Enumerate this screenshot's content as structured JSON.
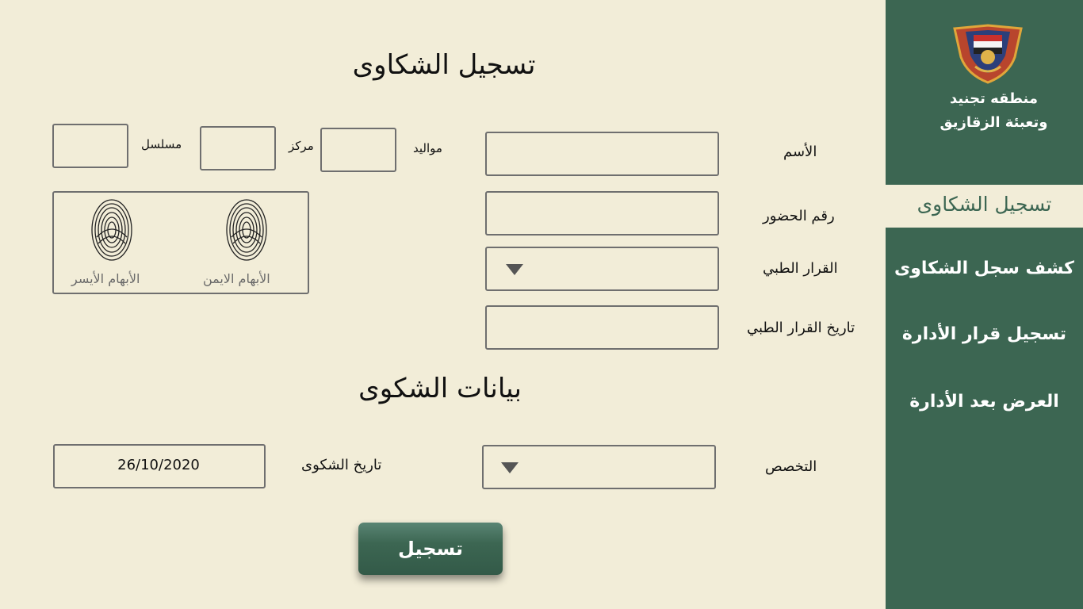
{
  "sidebar": {
    "org_line1": "منطقه تجنيد",
    "org_line2": "وتعبئة الزقازيق",
    "items": [
      {
        "label": "تسجيل الشكاوى",
        "active": true
      },
      {
        "label": "كشف  سجل الشكاوى",
        "active": false
      },
      {
        "label": "تسجيل قرار الأدارة",
        "active": false
      },
      {
        "label": "العرض بعد الأدارة",
        "active": false
      }
    ],
    "accent_color": "#3c6652"
  },
  "form": {
    "title": "تسجيل الشكاوى",
    "name_label": "الأسم",
    "attendance_label": "رقم الحضور",
    "medical_decision_label": "القرار الطبي",
    "medical_decision_date_label": "تاريخ القرار الطبي",
    "birth_label": "مواليد",
    "center_label": "مركز",
    "serial_label": "مسلسل",
    "right_thumb_label": "الأبهام الايمن",
    "left_thumb_label": "الأبهام الأيسر",
    "name_value": "",
    "attendance_value": "",
    "birth_value": "",
    "center_value": "",
    "serial_value": "",
    "medical_decision_date_value": ""
  },
  "complaint": {
    "title": "بيانات الشكوى",
    "specialty_label": "التخصص",
    "date_label": "تاريخ الشكوى",
    "date_value": "26/10/2020",
    "submit_label": "تسجيل"
  },
  "icons": {
    "dropdown": "caret-down-icon",
    "fingerprint": "fingerprint-icon",
    "logo": "emblem-logo"
  },
  "colors": {
    "background": "#f2edd8",
    "sidebar": "#3c6652",
    "border": "#6f6f6f"
  }
}
